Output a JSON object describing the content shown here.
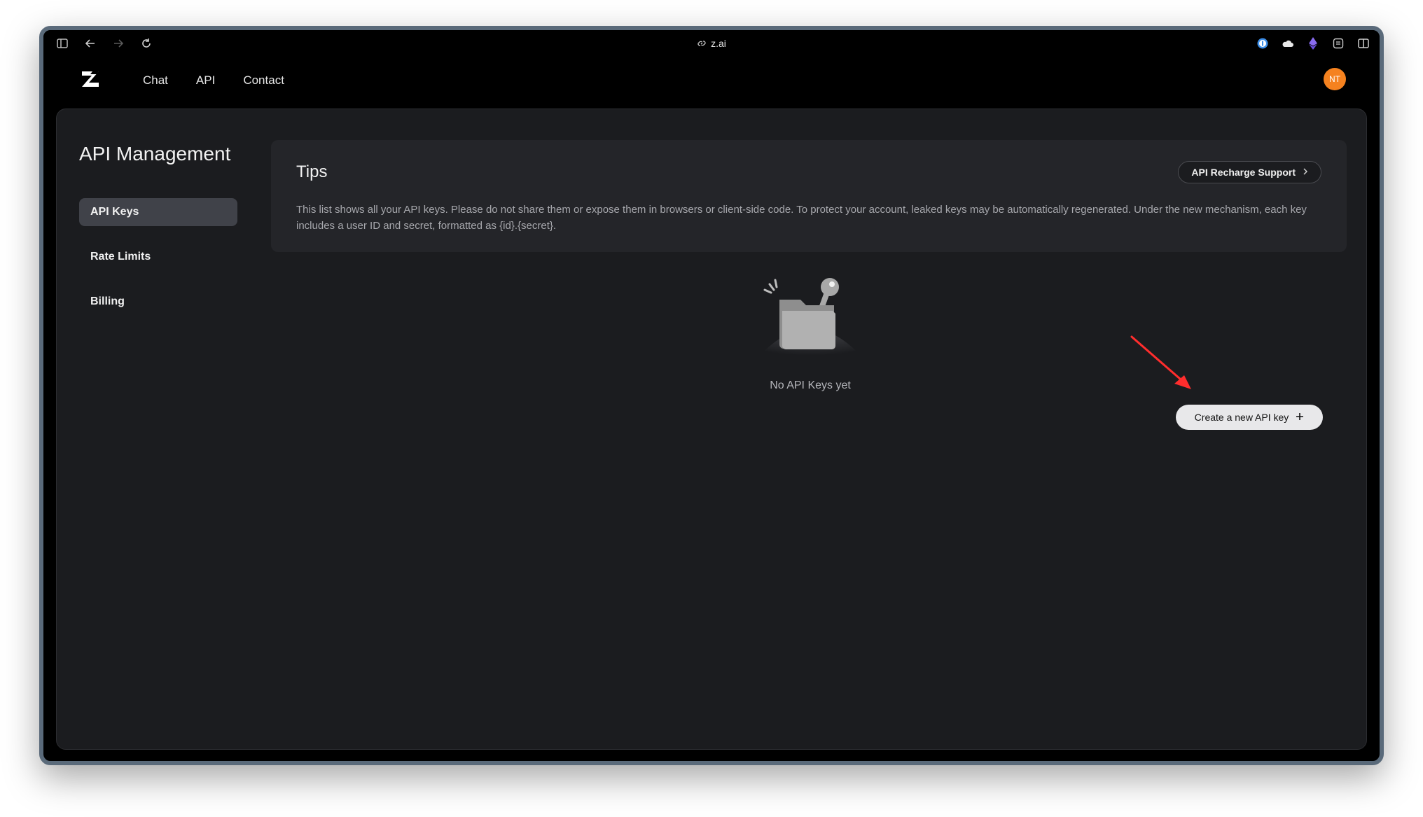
{
  "browser": {
    "url": "z.ai",
    "toolbar_icons": [
      "sidebar-icon",
      "back-icon",
      "forward-icon",
      "reload-icon"
    ],
    "extension_icons": [
      "password-manager-icon",
      "cloud-icon",
      "ethereum-icon",
      "reader-icon",
      "split-view-icon"
    ]
  },
  "header": {
    "logo": "Z",
    "nav": [
      {
        "label": "Chat"
      },
      {
        "label": "API"
      },
      {
        "label": "Contact"
      }
    ],
    "avatar_initials": "NT",
    "avatar_color": "#f5821f"
  },
  "sidebar": {
    "title": "API Management",
    "items": [
      {
        "label": "API Keys",
        "active": true
      },
      {
        "label": "Rate Limits",
        "active": false
      },
      {
        "label": "Billing",
        "active": false
      }
    ]
  },
  "tips": {
    "title": "Tips",
    "button_label": "API Recharge Support",
    "text": "This list shows all your API keys. Please do not share them or expose them in browsers or client-side code. To protect your account, leaked keys may be automatically regenerated. Under the new mechanism, each key includes a user ID and secret, formatted as {id}.{secret}."
  },
  "empty_state": {
    "message": "No API Keys yet"
  },
  "actions": {
    "create_label": "Create a new API key"
  },
  "annotation": {
    "arrow_color": "#ff2d2d"
  }
}
